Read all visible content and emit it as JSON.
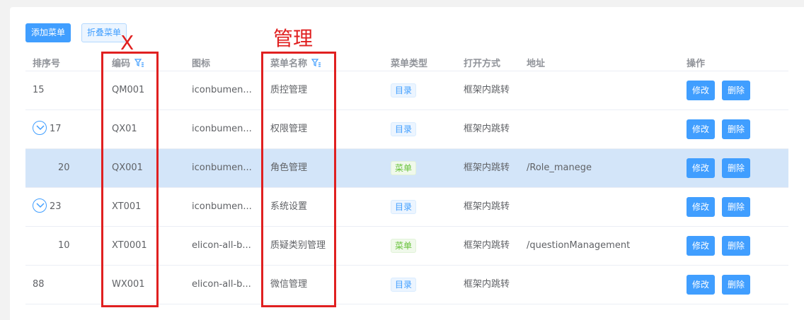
{
  "toolbar": {
    "add_label": "添加菜单",
    "collapse_label": "折叠菜单"
  },
  "columns": {
    "sort": "排序号",
    "code": "编码",
    "icon": "图标",
    "name": "菜单名称",
    "type": "菜单类型",
    "open": "打开方式",
    "address": "地址",
    "ops": "操作"
  },
  "rows": [
    {
      "sort": "15",
      "code": "QM001",
      "icon": "iconbumen...",
      "name": "质控管理",
      "type": "目录",
      "open": "框架内跳转",
      "address": "",
      "edit": "修改",
      "delete": "删除"
    },
    {
      "sort": "17",
      "code": "QX01",
      "icon": "iconbumen...",
      "name": "权限管理",
      "type": "目录",
      "open": "框架内跳转",
      "address": "",
      "edit": "修改",
      "delete": "删除"
    },
    {
      "sort": "20",
      "code": "QX001",
      "icon": "iconbumen...",
      "name": "角色管理",
      "type": "菜单",
      "open": "框架内跳转",
      "address": "/Role_manege",
      "edit": "修改",
      "delete": "删除"
    },
    {
      "sort": "23",
      "code": "XT001",
      "icon": "iconbumen...",
      "name": "系统设置",
      "type": "目录",
      "open": "框架内跳转",
      "address": "",
      "edit": "修改",
      "delete": "删除"
    },
    {
      "sort": "10",
      "code": "XT0001",
      "icon": "elicon-all-b...",
      "name": "质疑类别管理",
      "type": "菜单",
      "open": "框架内跳转",
      "address": "/questionManagement",
      "edit": "修改",
      "delete": "删除"
    },
    {
      "sort": "88",
      "code": "WX001",
      "icon": "elicon-all-b...",
      "name": "微信管理",
      "type": "目录",
      "open": "框架内跳转",
      "address": "",
      "edit": "修改",
      "delete": "删除"
    }
  ],
  "annotations": {
    "x_label": "X",
    "manage_label": "管理"
  },
  "icons": {
    "filter": "filter-icon",
    "expand": "chevron-down-circle-icon"
  },
  "colors": {
    "primary": "#409eff",
    "highlight_row": "#d3e5f9",
    "annotation": "#e02020",
    "tag_menu": "#67c23a"
  }
}
